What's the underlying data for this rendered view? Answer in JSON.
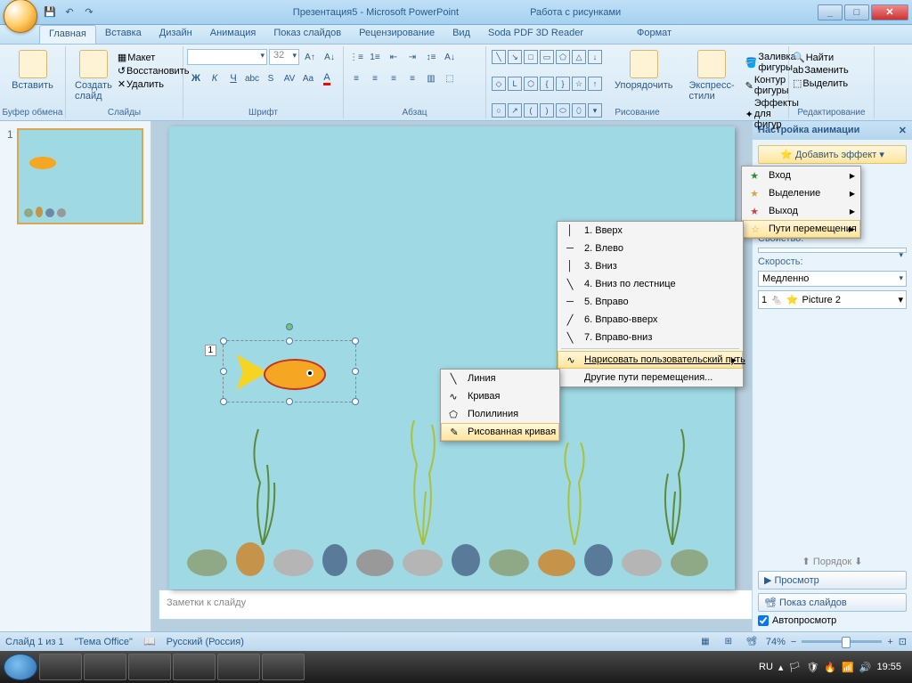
{
  "titlebar": {
    "doc": "Презентация5 - Microsoft PowerPoint",
    "context": "Работа с рисунками"
  },
  "tabs": [
    "Главная",
    "Вставка",
    "Дизайн",
    "Анимация",
    "Показ слайдов",
    "Рецензирование",
    "Вид",
    "Soda PDF 3D Reader",
    "Формат"
  ],
  "groups": {
    "clipboard": "Буфер обмена",
    "slides": "Слайды",
    "font": "Шрифт",
    "paragraph": "Абзац",
    "drawing": "Рисование",
    "editing": "Редактирование"
  },
  "buttons": {
    "paste": "Вставить",
    "newslide": "Создать слайд",
    "layout": "Макет",
    "reset": "Восстановить",
    "delete": "Удалить",
    "arrange": "Упорядочить",
    "quickstyles": "Экспресс-стили",
    "shapefill": "Заливка фигуры",
    "shapeoutline": "Контур фигуры",
    "shapeeffects": "Эффекты для фигур",
    "find": "Найти",
    "replace": "Заменить",
    "select": "Выделить"
  },
  "font": {
    "size": "32"
  },
  "taskpane": {
    "title": "Настройка анимации",
    "addeffect": "Добавить эффект",
    "property": "Свойство:",
    "speed": "Скорость:",
    "speedval": "Медленно",
    "item": "Picture 2",
    "order": "Порядок",
    "preview": "Просмотр",
    "slideshow": "Показ слайдов",
    "autopreview": "Автопросмотр"
  },
  "effect_menu": [
    {
      "ico": "★",
      "label": "Вход",
      "color": "#2e8b2e"
    },
    {
      "ico": "★",
      "label": "Выделение",
      "color": "#d4a847"
    },
    {
      "ico": "★",
      "label": "Выход",
      "color": "#c94545"
    },
    {
      "ico": "☆",
      "label": "Пути перемещения",
      "color": "#d4a847",
      "hover": true
    }
  ],
  "path_menu": [
    {
      "ico": "│",
      "label": "1. Вверх"
    },
    {
      "ico": "─",
      "label": "2. Влево"
    },
    {
      "ico": "│",
      "label": "3. Вниз"
    },
    {
      "ico": "╲",
      "label": "4. Вниз по лестнице"
    },
    {
      "ico": "─",
      "label": "5. Вправо"
    },
    {
      "ico": "╱",
      "label": "6. Вправо-вверх"
    },
    {
      "ico": "╲",
      "label": "7. Вправо-вниз"
    },
    {
      "ico": "∿",
      "label": "Нарисовать пользовательский путь",
      "arrow": true,
      "hover": true
    },
    {
      "label": "Другие пути перемещения..."
    }
  ],
  "custom_menu": [
    {
      "ico": "╲",
      "label": "Линия"
    },
    {
      "ico": "∿",
      "label": "Кривая"
    },
    {
      "ico": "⬠",
      "label": "Полилиния"
    },
    {
      "ico": "✎",
      "label": "Рисованная кривая",
      "hover": true
    }
  ],
  "notes": "Заметки к слайду",
  "status": {
    "slide": "Слайд 1 из 1",
    "theme": "\"Тема Office\"",
    "lang": "Русский (Россия)",
    "zoom": "74%"
  },
  "tray": {
    "lang": "RU",
    "time": "19:55"
  }
}
